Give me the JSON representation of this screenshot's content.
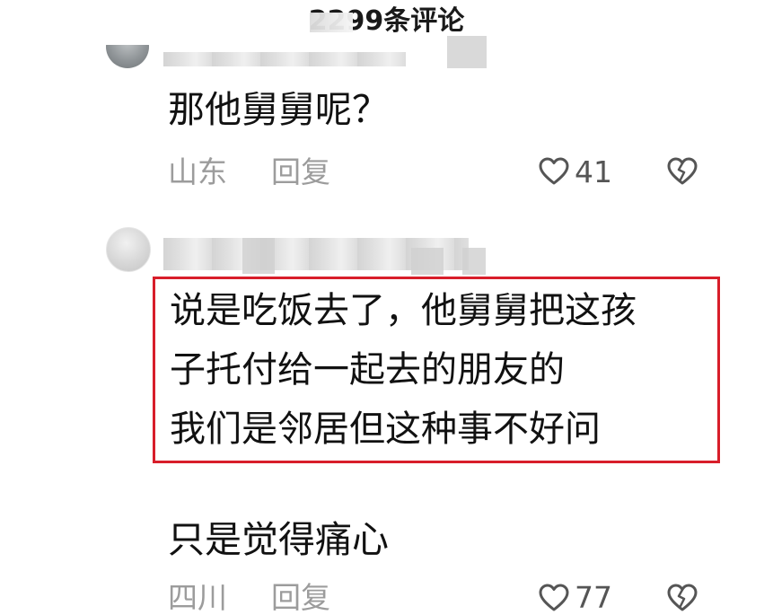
{
  "header": {
    "title": "2299条评论"
  },
  "comments": [
    {
      "text": "那他舅舅呢？",
      "location": "山东",
      "reply_label": "回复",
      "likes": "41",
      "like_icon": "heart-outline-icon",
      "dislike_icon": "broken-heart-icon"
    },
    {
      "lines": [
        "说是吃饭去了，他舅舅把这孩",
        "子托付给一起去的朋友的",
        "我们是邻居但这种事不好问"
      ],
      "highlight_color": "#d81e2a"
    },
    {
      "text": "只是觉得痛心",
      "location": "四川",
      "reply_label": "回复",
      "likes": "77",
      "like_icon": "heart-outline-icon",
      "dislike_icon": "broken-heart-icon"
    }
  ]
}
